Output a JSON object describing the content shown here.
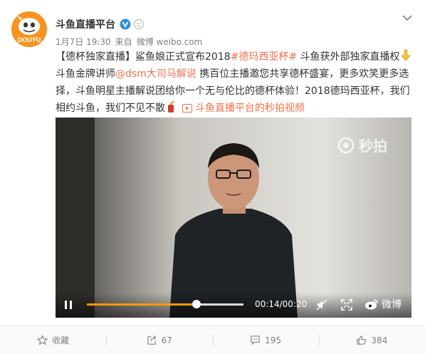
{
  "author": {
    "name": "斗鱼直播平台",
    "avatar_text": "DOUYU"
  },
  "meta": {
    "time": "1月7日 19:30",
    "from_label": "来自",
    "source": "微博 weibo.com"
  },
  "post": {
    "part1": "【德杯独家直播】鲨鱼娘正式宣布2018",
    "topic": "#德玛西亚杯#",
    "part2": " 斗鱼获外部独家直播权",
    "part3": "斗鱼金牌讲师",
    "mention": "@dsm大司马解说",
    "part4": " 携百位主播邀您共享德杯盛宴，更多欢笑更多选择，斗鱼明星主播解说团给你一个无与伦比的德杯体验！2018德玛西亚杯，我们相约斗鱼，我们不见不散",
    "video_link": "斗鱼直播平台的秒拍视频"
  },
  "video": {
    "watermark": "秒拍",
    "time": "00:14/00:20",
    "progress": 0.7,
    "brand": "微博"
  },
  "actions": {
    "favorite": "收藏",
    "repost": "67",
    "comment": "195",
    "like": "384"
  },
  "colors": {
    "link": "#eb7350",
    "progress": "#ff9a00",
    "brand_orange": "#f7931e"
  }
}
